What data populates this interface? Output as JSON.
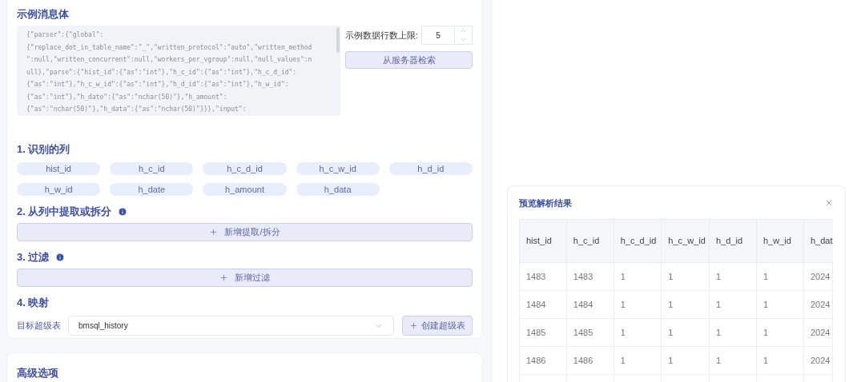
{
  "message_sample": {
    "title": "示例消息体",
    "lines": [
      "{\"parser\":{\"global\":",
      "{\"replace_dot_in_table_name\":\"_\",\"written_protocol\":\"auto\",\"written_method",
      "\":null,\"written_concurrent\":null,\"workers_per_vgroup\":null,\"null_values\":n",
      "ull},\"parse\":{\"hist_id\":{\"as\":\"int\"},\"h_c_id\":{\"as\":\"int\"},\"h_c_d_id\":",
      "{\"as\":\"int\"},\"h_c_w_id\":{\"as\":\"int\"},\"h_d_id\":{\"as\":\"int\"},\"h_w_id\":",
      "{\"as\":\"int\"},\"h_date\":{\"as\":\"nchar(50)\"},\"h_amount\":",
      "{\"as\":\"nchar(50)\"},\"h_data\":{\"as\":\"nchar(50)\"}}},\"input\":"
    ],
    "row_limit_label": "示例数据行数上限:",
    "row_limit_value": "5",
    "fetch_button": "从服务器检索"
  },
  "sections": [
    {
      "kind": "columns",
      "title": "1. 识别的列",
      "info": false,
      "columns": [
        "hist_id",
        "h_c_id",
        "h_c_d_id",
        "h_c_w_id",
        "h_d_id",
        "h_w_id",
        "h_date",
        "h_amount",
        "h_data"
      ]
    },
    {
      "kind": "add",
      "title": "2. 从列中提取或拆分",
      "info": true,
      "button": "新增提取/拆分"
    },
    {
      "kind": "add",
      "title": "3. 过滤",
      "info": true,
      "button": "新增过滤"
    },
    {
      "kind": "mapping",
      "title": "4. 映射",
      "info": false,
      "label": "目标超级表",
      "value": "bmsql_history",
      "button": "创建超级表"
    }
  ],
  "advanced": {
    "title": "高级选项"
  },
  "preview": {
    "title": "预览解析结果",
    "columns": [
      "hist_id",
      "h_c_id",
      "h_c_d_id",
      "h_c_w_id",
      "h_d_id",
      "h_w_id",
      "h_dat"
    ],
    "rows": [
      [
        "1483",
        "1483",
        "1",
        "1",
        "1",
        "1",
        "2024"
      ],
      [
        "1484",
        "1484",
        "1",
        "1",
        "1",
        "1",
        "2024"
      ],
      [
        "1485",
        "1485",
        "1",
        "1",
        "1",
        "1",
        "2024"
      ],
      [
        "1486",
        "1486",
        "1",
        "1",
        "1",
        "1",
        "2024"
      ]
    ]
  }
}
